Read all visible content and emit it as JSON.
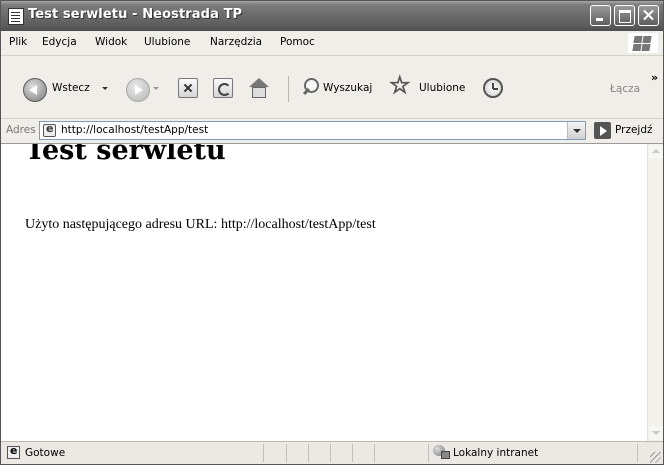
{
  "window": {
    "title": "Test serwletu - Neostrada TP"
  },
  "menu": {
    "items": [
      "Plik",
      "Edycja",
      "Widok",
      "Ulubione",
      "Narzędzia",
      "Pomoc"
    ]
  },
  "toolbar": {
    "back_label": "Wstecz",
    "search_label": "Wyszukaj",
    "favorites_label": "Ulubione",
    "links_label": "Łącza"
  },
  "address": {
    "label": "Adres",
    "url": "http://localhost/testApp/test",
    "go_label": "Przejdź"
  },
  "content": {
    "heading": "Test serwletu",
    "text": "Użyto następującego adresu URL: http://localhost/testApp/test"
  },
  "status": {
    "text": "Gotowe",
    "zone": "Lokalny intranet"
  }
}
